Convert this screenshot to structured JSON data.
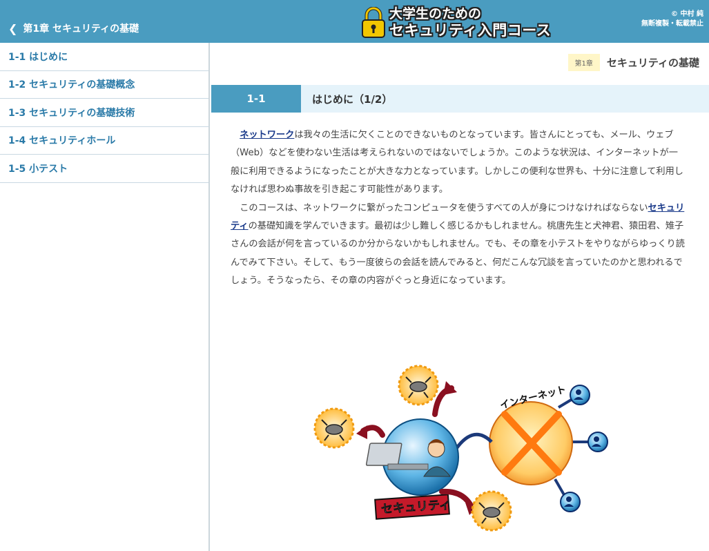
{
  "header": {
    "back_label": "第1章 セキュリティの基礎",
    "logo_line1": "大学生のための",
    "logo_line2": "セキュリティ入門コース",
    "copyright_line1": "© 中村 純",
    "copyright_line2": "無断複製・転載禁止"
  },
  "sidebar": {
    "items": [
      {
        "label": "1-1 はじめに"
      },
      {
        "label": "1-2 セキュリティの基礎概念"
      },
      {
        "label": "1-3 セキュリティの基礎技術"
      },
      {
        "label": "1-4 セキュリティホール"
      },
      {
        "label": "1-5 小テスト"
      }
    ]
  },
  "main": {
    "chapter_badge": "第1章",
    "chapter_title": "セキュリティの基礎",
    "section_number": "1-1",
    "section_title": "はじめに（1/2）",
    "para1_kw": "ネットワーク",
    "para1_rest": "は我々の生活に欠くことのできないものとなっています。皆さんにとっても、メール、ウェブ（Web）などを使わない生活は考えられないのではないでしょうか。このような状況は、インターネットが一般に利用できるようになったことが大きな力となっています。しかしこの便利な世界も、十分に注意して利用しなければ思わぬ事故を引き起こす可能性があります。",
    "para2_pre": "このコースは、ネットワークに繋がったコンピュータを使うすべての人が身につけなければならない",
    "para2_kw": "セキュリティ",
    "para2_rest": "の基礎知識を学んでいきます。最初は少し難しく感じるかもしれません。桃唐先生と犬神君、猿田君、雉子さんの会話が何を言っているのか分からないかもしれません。でも、その章を小テストをやりながらゆっくり読んでみて下さい。そして、もう一度彼らの会話を読んでみると、何だこんな冗談を言っていたのかと思われるでしょう。そうなったら、その章の内容がぐっと身近になっています。",
    "illust_internet_label": "インターネット",
    "illust_security_label": "セキュリティ"
  },
  "colors": {
    "accent": "#4a9cc0",
    "sidebar_link": "#2a7aa8",
    "section_bg": "#e5f3fa",
    "badge_bg": "#fff6c8"
  }
}
